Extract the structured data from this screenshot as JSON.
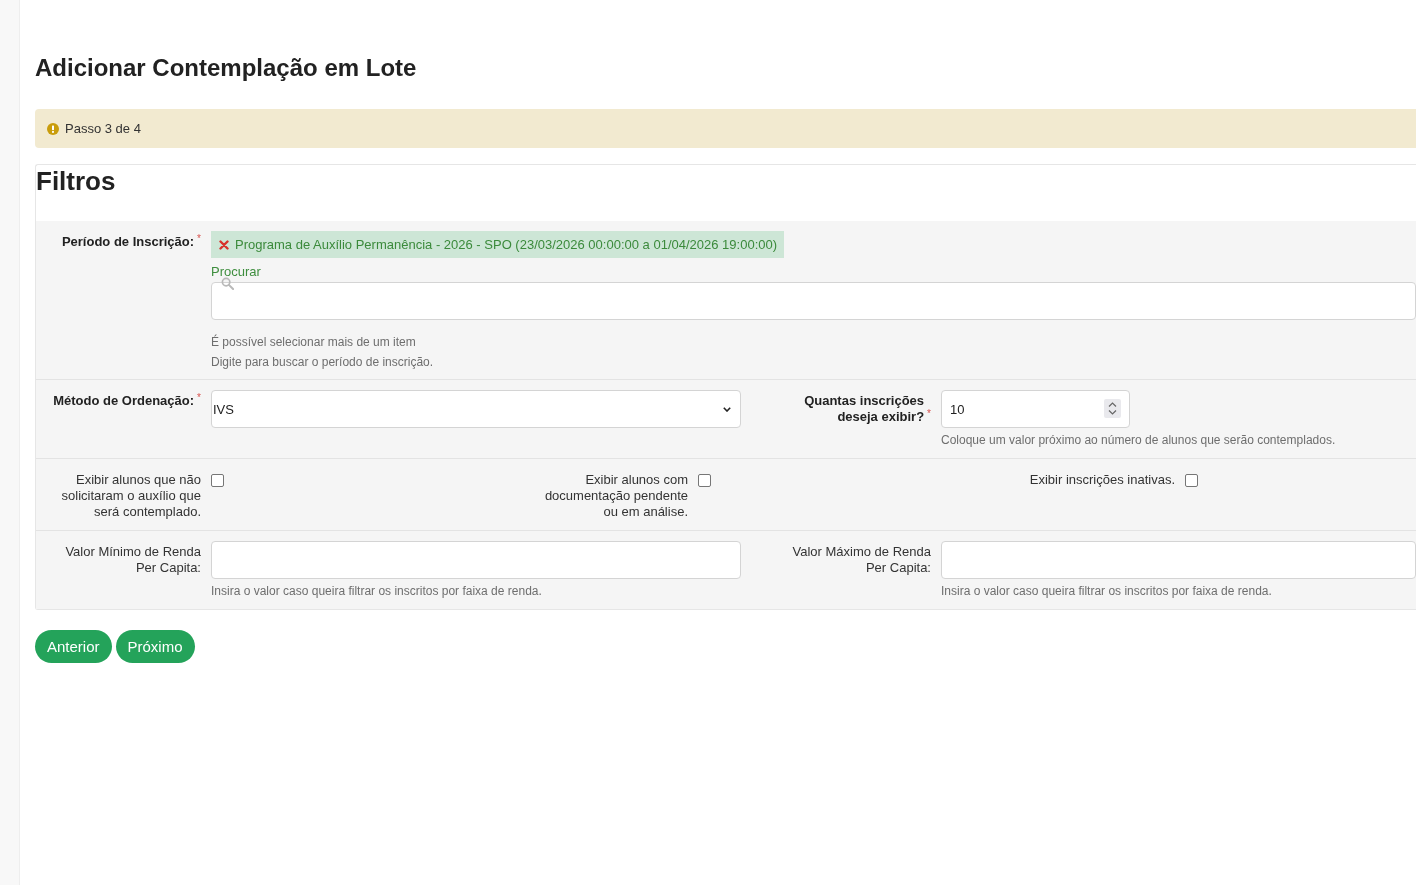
{
  "page_title": "Adicionar Contemplação em Lote",
  "alert": {
    "text": "Passo 3 de 4"
  },
  "filters": {
    "title": "Filtros",
    "period": {
      "label": "Período de Inscrição:",
      "required": true,
      "required_mark": "*",
      "chips": [
        {
          "text": "Programa de Auxílio Permanência - 2026 - SPO (23/03/2026 00:00:00 a 01/04/2026 19:00:00)"
        }
      ],
      "search_label": "Procurar",
      "help": [
        "É possível selecionar mais de um item",
        "Digite para buscar o período de inscrição."
      ]
    },
    "ordering": {
      "label": "Método de Ordenação:",
      "required": true,
      "required_mark": "*",
      "value": "IVS"
    },
    "count": {
      "label": "Quantas inscrições deseja exibir?",
      "required": true,
      "required_mark": "*",
      "value": "10",
      "help": "Coloque um valor próximo ao número de alunos que serão contemplados."
    },
    "options": [
      {
        "label": "Exibir alunos que não solicitaram o auxílio que será contemplado.",
        "checked": false
      },
      {
        "label": "Exibir alunos com documentação pendente ou em análise.",
        "checked": false
      },
      {
        "label": "Exibir inscrições inativas.",
        "checked": false
      }
    ],
    "income": [
      {
        "label": "Valor Mínimo de Renda Per Capita:",
        "required": false,
        "help": "Insira o valor caso queira filtrar os inscritos por faixa de renda."
      },
      {
        "label": "Valor Máximo de Renda Per Capita:",
        "required": false,
        "help": "Insira o valor caso queira filtrar os inscritos por faixa de renda."
      }
    ]
  },
  "buttons": [
    {
      "label": "Anterior"
    },
    {
      "label": "Próximo"
    }
  ]
}
